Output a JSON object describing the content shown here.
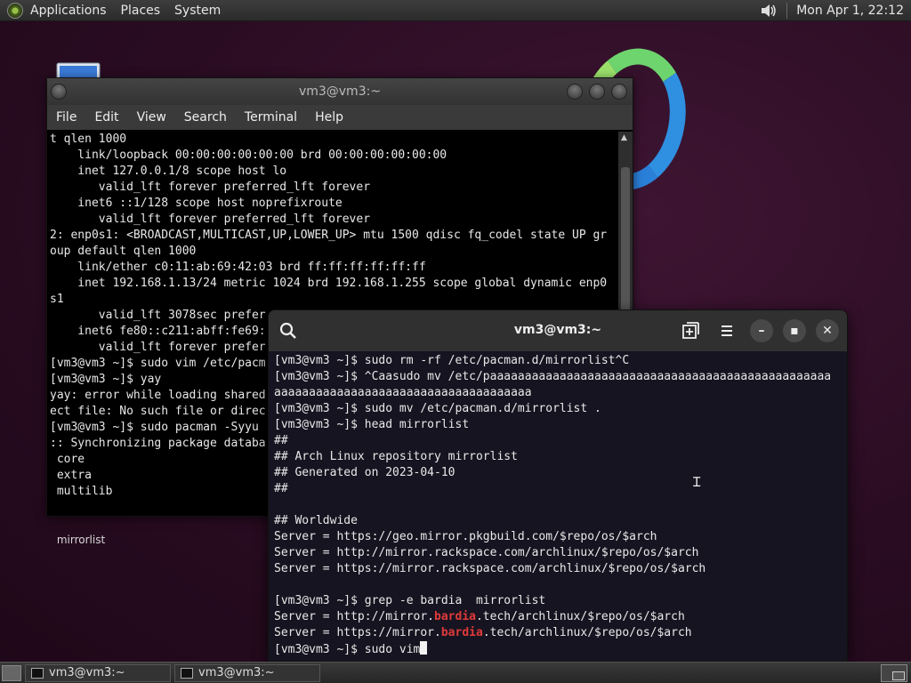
{
  "top_panel": {
    "menus": [
      "Applications",
      "Places",
      "System"
    ],
    "clock": "Mon Apr  1, 22:12"
  },
  "desktop": {
    "icon_label": "mirrorlist"
  },
  "back_window": {
    "title": "vm3@vm3:~",
    "menu": [
      "File",
      "Edit",
      "View",
      "Search",
      "Terminal",
      "Help"
    ],
    "lines": [
      "t qlen 1000",
      "    link/loopback 00:00:00:00:00:00 brd 00:00:00:00:00:00",
      "    inet 127.0.0.1/8 scope host lo",
      "       valid_lft forever preferred_lft forever",
      "    inet6 ::1/128 scope host noprefixroute",
      "       valid_lft forever preferred_lft forever",
      "2: enp0s1: <BROADCAST,MULTICAST,UP,LOWER_UP> mtu 1500 qdisc fq_codel state UP gr",
      "oup default qlen 1000",
      "    link/ether c0:11:ab:69:42:03 brd ff:ff:ff:ff:ff:ff",
      "    inet 192.168.1.13/24 metric 1024 brd 192.168.1.255 scope global dynamic enp0",
      "s1",
      "       valid_lft 3078sec prefer",
      "    inet6 fe80::c211:abff:fe69:",
      "       valid_lft forever prefer",
      "[vm3@vm3 ~]$ sudo vim /etc/pacm",
      "[vm3@vm3 ~]$ yay",
      "yay: error while loading shared",
      "ect file: No such file or direc",
      "[vm3@vm3 ~]$ sudo pacman -Syyu",
      ":: Synchronizing package databa",
      " core",
      " extra",
      " multilib"
    ]
  },
  "front_window": {
    "title": "vm3@vm3:~",
    "lines": [
      "[vm3@vm3 ~]$ sudo rm -rf /etc/pacman.d/mirrorlist^C",
      "[vm3@vm3 ~]$ ^Caasudo mv /etc/paaaaaaaaaaaaaaaaaaaaaaaaaaaaaaaaaaaaaaaaaaaaaaaaa",
      "aaaaaaaaaaaaaaaaaaaaaaaaaaaaaaaaaaaaa",
      "[vm3@vm3 ~]$ sudo mv /etc/pacman.d/mirrorlist .",
      "[vm3@vm3 ~]$ head mirrorlist",
      "##",
      "## Arch Linux repository mirrorlist",
      "## Generated on 2023-04-10",
      "##",
      "",
      "## Worldwide",
      "Server = https://geo.mirror.pkgbuild.com/$repo/os/$arch",
      "Server = http://mirror.rackspace.com/archlinux/$repo/os/$arch",
      "Server = https://mirror.rackspace.com/archlinux/$repo/os/$arch",
      "",
      "[vm3@vm3 ~]$ grep -e bardia  mirrorlist"
    ],
    "grep_results": [
      {
        "pre": "Server = http://mirror.",
        "match": "bardia",
        "post": ".tech/archlinux/$repo/os/$arch"
      },
      {
        "pre": "Server = https://mirror.",
        "match": "bardia",
        "post": ".tech/archlinux/$repo/os/$arch"
      }
    ],
    "prompt_line": "[vm3@vm3 ~]$ sudo vim",
    "highlight_color": "#e03a3a"
  },
  "taskbar": {
    "tasks": [
      "vm3@vm3:~",
      "vm3@vm3:~"
    ]
  }
}
